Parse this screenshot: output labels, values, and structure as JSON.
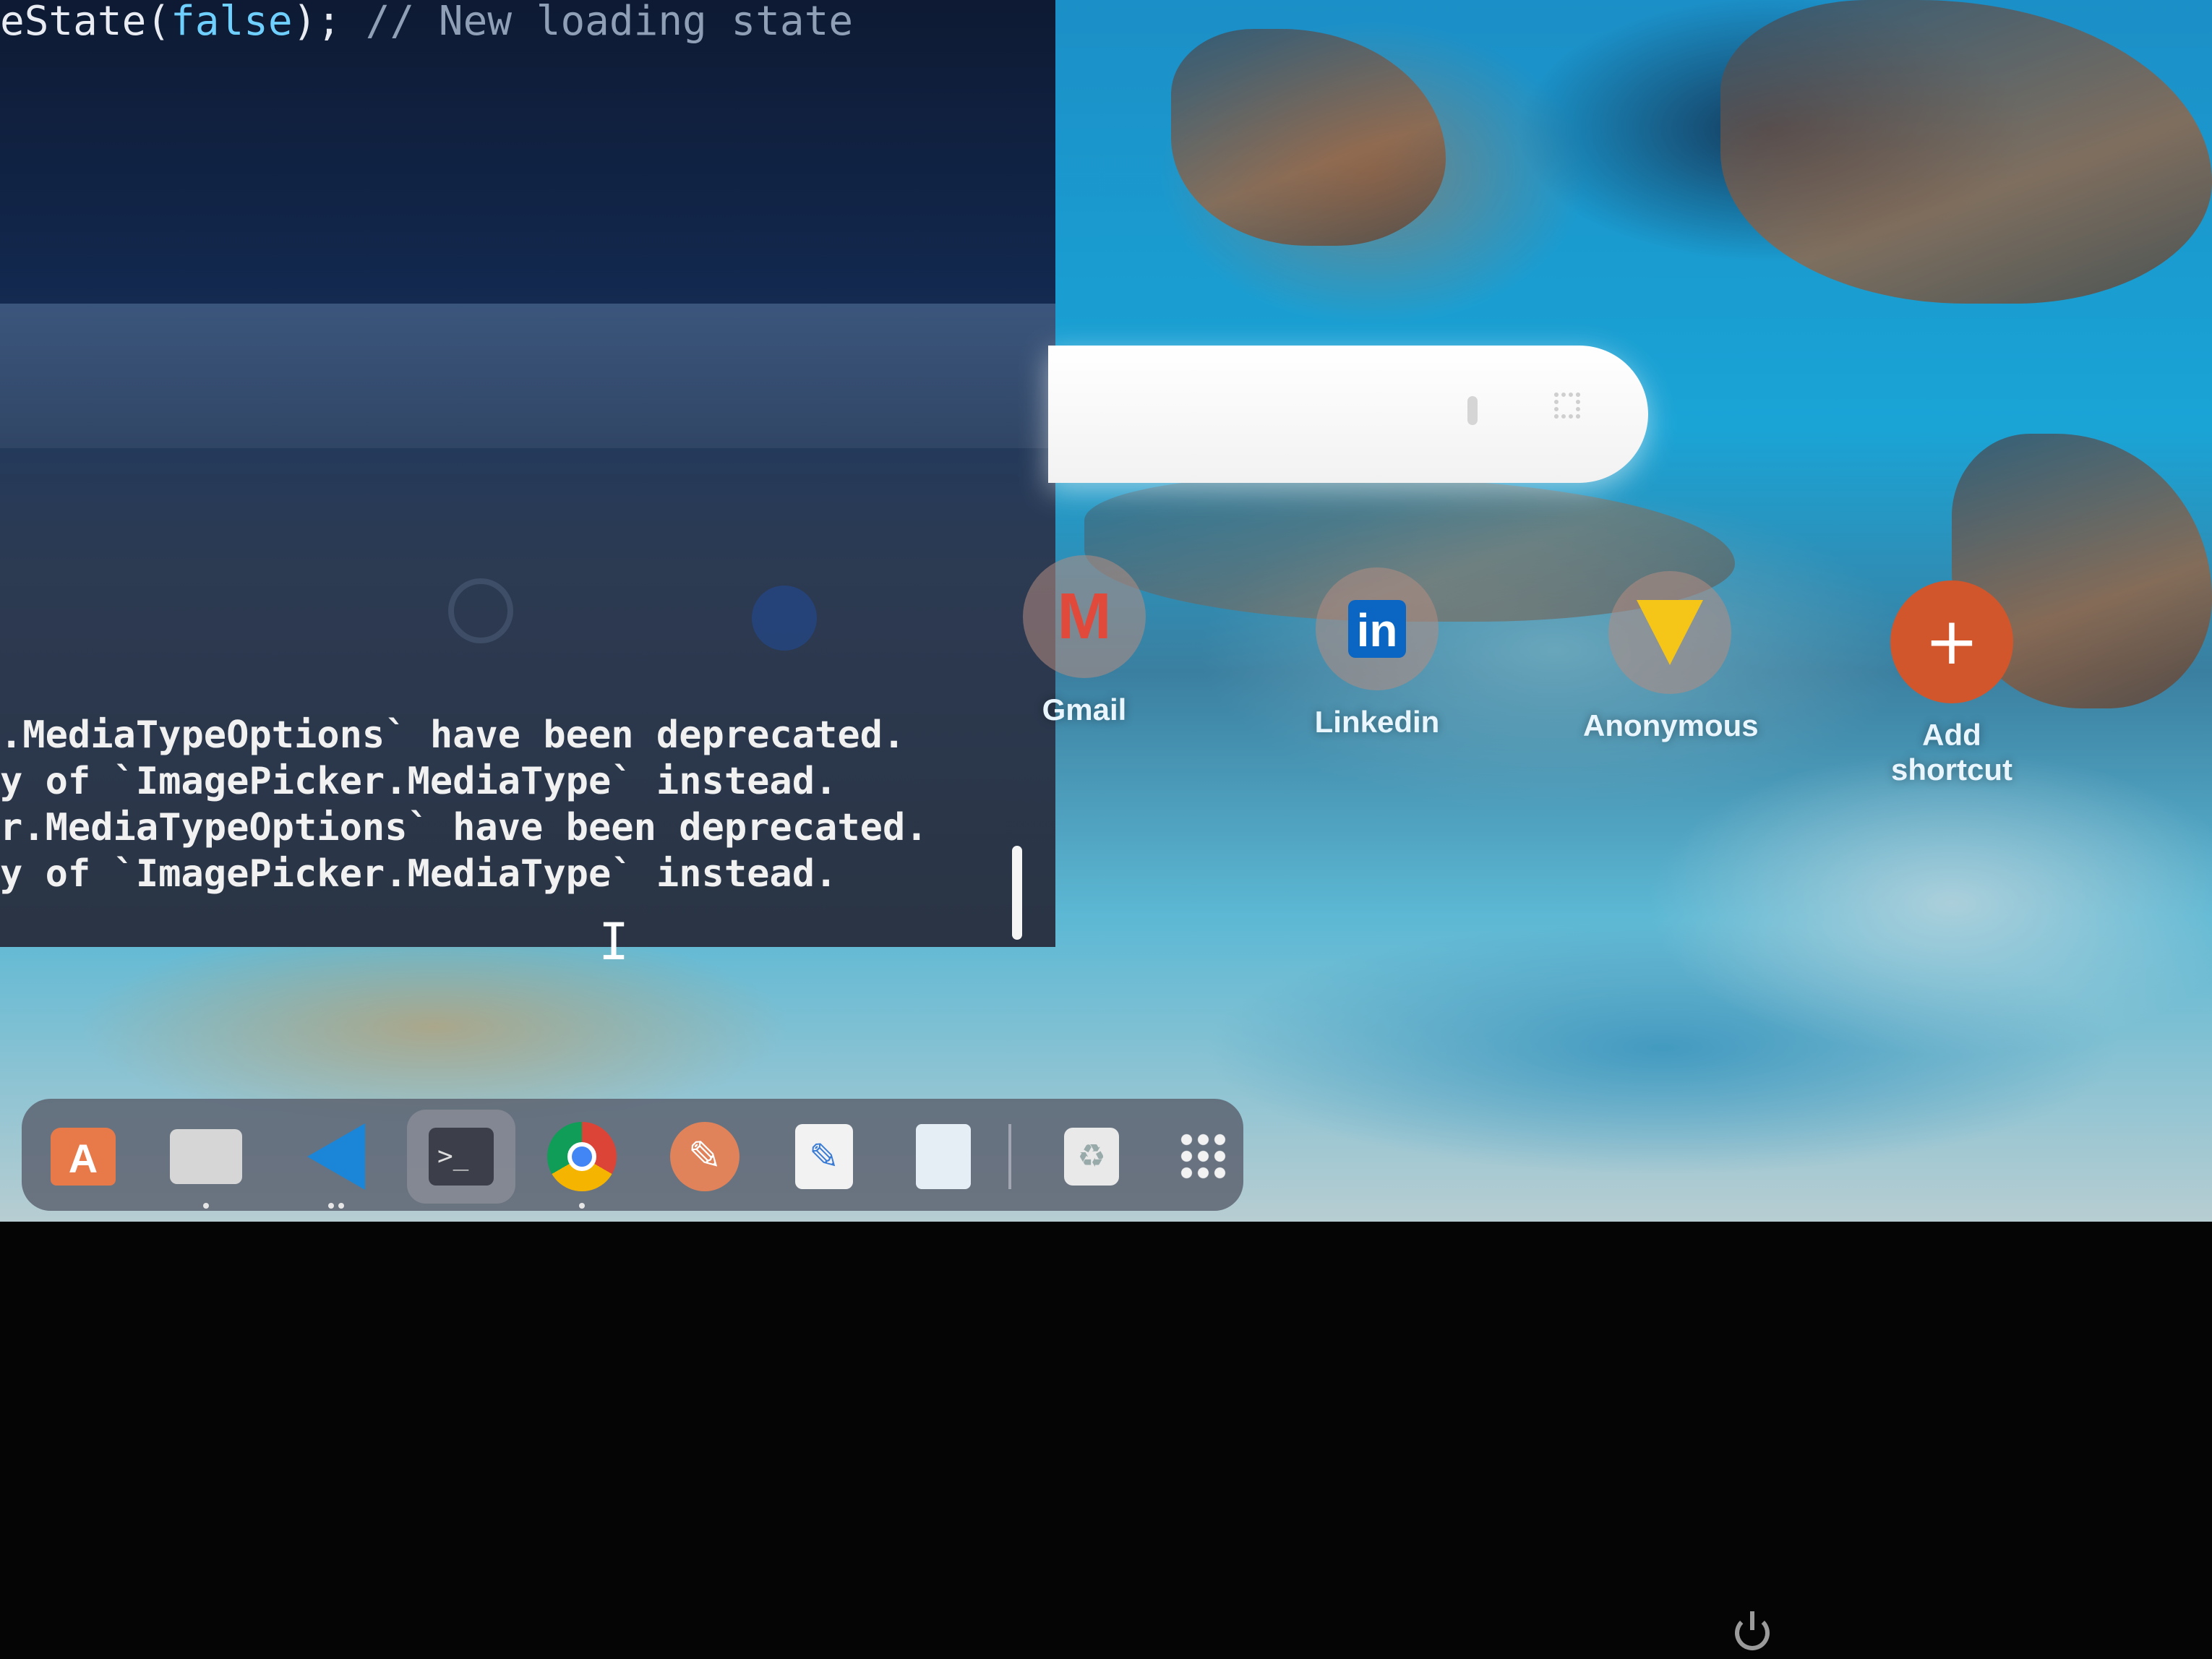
{
  "terminal": {
    "code_prefix": "eState(",
    "code_keyword": "false",
    "code_suffix": "); ",
    "code_comment": "// New loading state",
    "tab_label": "",
    "output_lines": [
      ".MediaTypeOptions` have been deprecated.",
      "y of `ImagePicker.MediaType` instead.",
      "r.MediaTypeOptions` have been deprecated.",
      "y of `ImagePicker.MediaType` instead."
    ]
  },
  "browser": {
    "search_placeholder": "",
    "shortcuts": [
      {
        "label": "Gmail",
        "icon": "gmail-icon"
      },
      {
        "label": "Linkedin",
        "icon": "linkedin-icon"
      },
      {
        "label": "Anonymous",
        "icon": "vite-icon"
      },
      {
        "label": "Add shortcut",
        "icon": "plus-icon"
      }
    ]
  },
  "dock": {
    "items": [
      {
        "name": "app-center",
        "icon": "app-center-icon",
        "glyph": "A"
      },
      {
        "name": "files",
        "icon": "folder-icon"
      },
      {
        "name": "vscode",
        "icon": "vscode-icon"
      },
      {
        "name": "terminal",
        "icon": "terminal-icon",
        "glyph": ">_"
      },
      {
        "name": "chrome",
        "icon": "chrome-icon"
      },
      {
        "name": "editor",
        "icon": "pen-icon",
        "glyph": "✎"
      },
      {
        "name": "text-editor",
        "icon": "text-editor-icon",
        "glyph": "✎"
      },
      {
        "name": "document",
        "icon": "document-icon"
      },
      {
        "name": "trash",
        "icon": "trash-icon",
        "glyph": "♻"
      },
      {
        "name": "app-grid",
        "icon": "app-grid-icon"
      }
    ]
  },
  "colors": {
    "terminal_bg": "#12284e",
    "accent_add": "#d2562c",
    "dock_bg": "#5a5f6e"
  }
}
